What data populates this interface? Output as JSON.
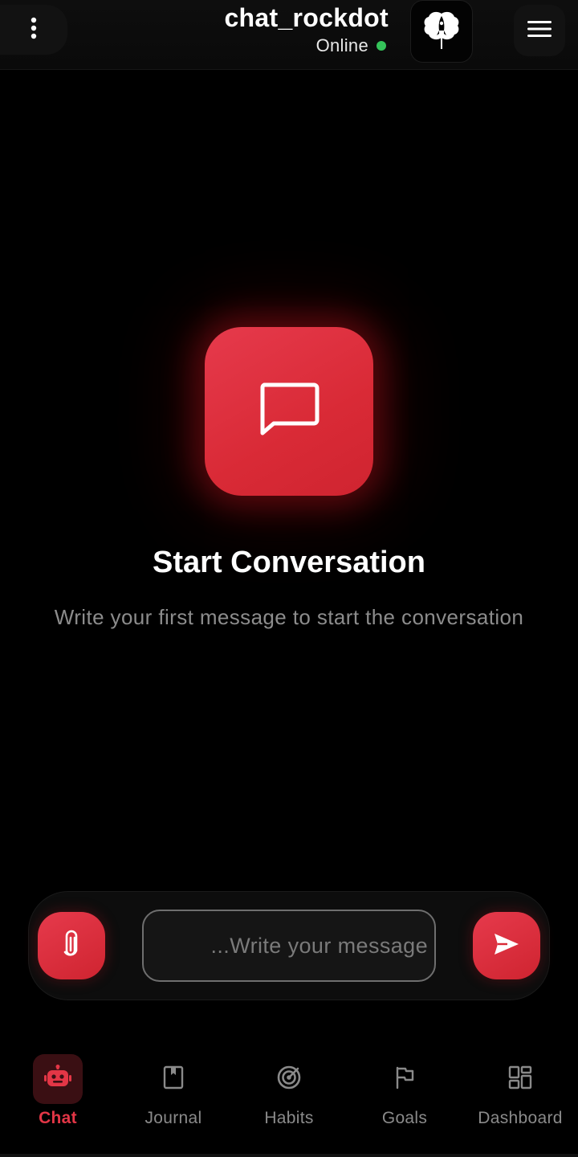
{
  "header": {
    "title": "chat_rockdot",
    "status": "Online",
    "status_color": "#35c35a",
    "menu_icon": "more-vertical-icon",
    "avatar_icon": "brain-rocket-icon",
    "hamburger_icon": "menu-icon"
  },
  "empty_state": {
    "icon": "message-square-icon",
    "title": "Start Conversation",
    "subtitle": "Write your first message to start the conversation"
  },
  "composer": {
    "placeholder": "...Write your message",
    "attach_icon": "paperclip-icon",
    "send_icon": "send-icon"
  },
  "nav": {
    "items": [
      {
        "label": "Chat",
        "icon": "robot-icon",
        "active": true
      },
      {
        "label": "Journal",
        "icon": "book-icon",
        "active": false
      },
      {
        "label": "Habits",
        "icon": "target-icon",
        "active": false
      },
      {
        "label": "Goals",
        "icon": "flag-icon",
        "active": false
      },
      {
        "label": "Dashboard",
        "icon": "dashboard-icon",
        "active": false
      }
    ]
  },
  "colors": {
    "accent": "#e33646",
    "background": "#000000",
    "muted_text": "#8c8c8c"
  }
}
